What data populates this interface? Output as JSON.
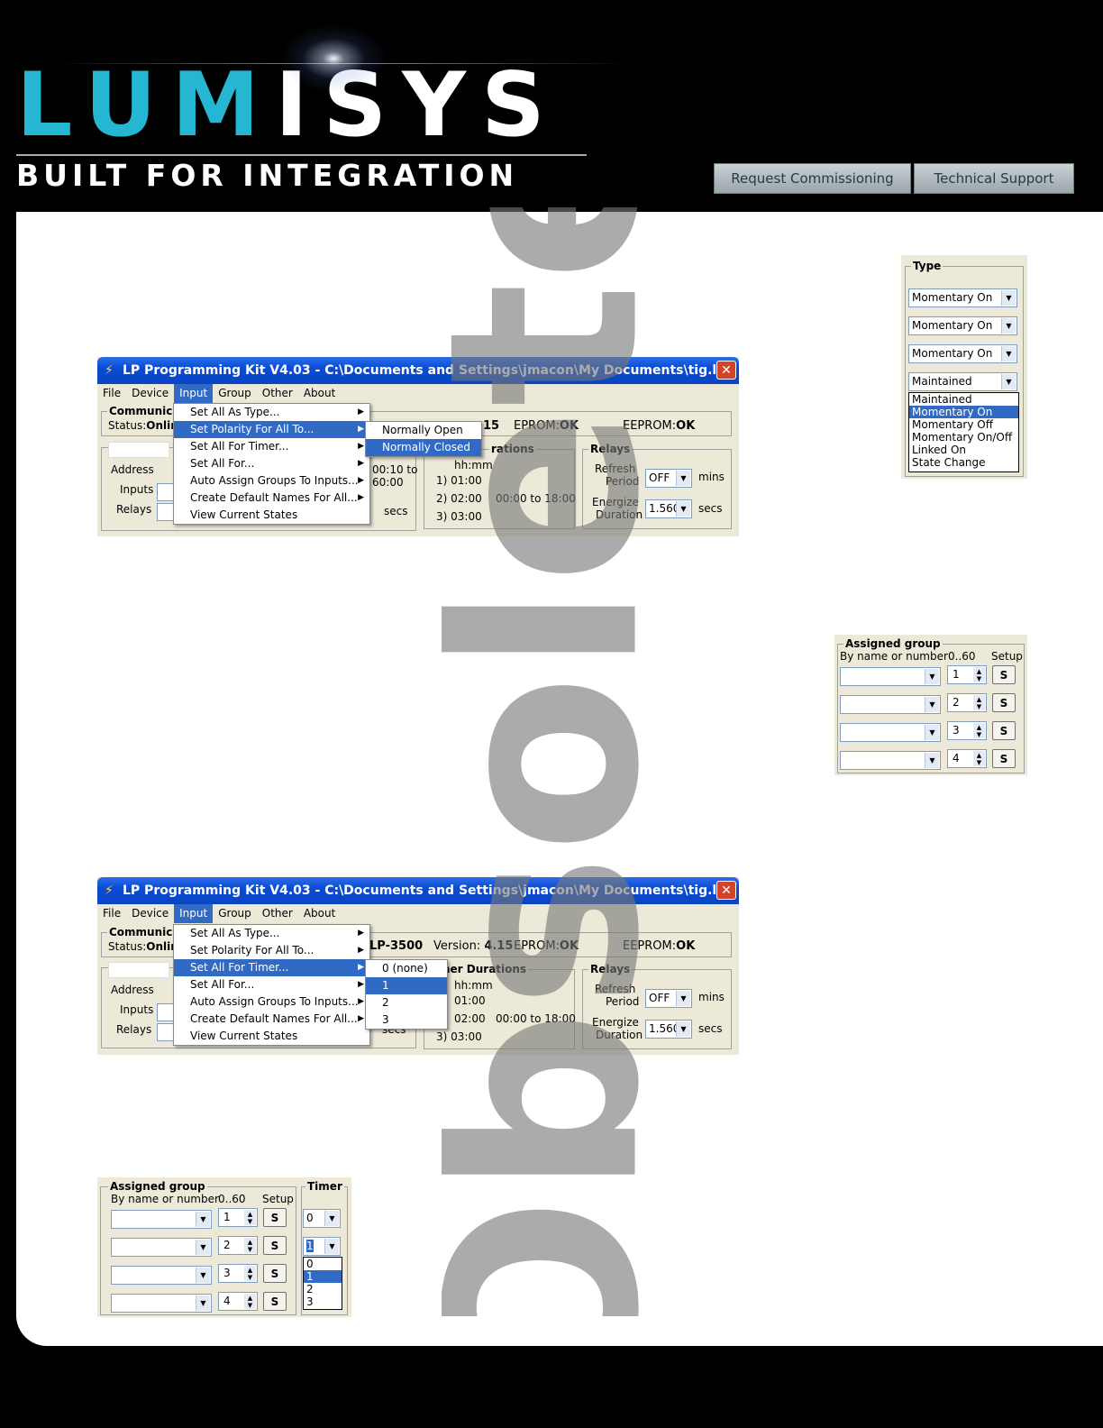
{
  "header": {
    "logo_lu": "LUM",
    "logo_i": "I",
    "logo_sys": "SYS",
    "tagline": "BUILT FOR INTEGRATION",
    "buttons": [
      "Request Commissioning",
      "Technical Support"
    ]
  },
  "watermark": "Obsolete",
  "window1": {
    "title": "LP Programming Kit V4.03 - C:\\Documents and Settings\\jmacon\\My Documents\\tig.lpx",
    "menu": [
      "File",
      "Device",
      "Input",
      "Group",
      "Other",
      "About"
    ],
    "comm_title": "Communica",
    "status_label": "Status:",
    "status_value": "Onlin",
    "version_partial": "15",
    "eprom_label": "EPROM:",
    "eprom_value": "OK",
    "eeprom_label": "EEPROM:",
    "eeprom_value": "OK",
    "address_label": "Address",
    "inputs_label": "Inputs",
    "relays_label": "Relays",
    "timer_range_a": "00:10 to",
    "timer_range_b": "60:00",
    "secs": "secs",
    "durations_title": "rations",
    "hhmm": "hh:mm",
    "durations": [
      "1)  01:00",
      "2)  02:00",
      "3)  03:00"
    ],
    "dur_range": "00:00 to 18:00",
    "relays_title": "Relays",
    "refresh_label_a": "Refresh",
    "refresh_label_b": "Period",
    "refresh_value": "OFF",
    "mins": "mins",
    "energize_label_a": "Energize",
    "energize_label_b": "Duration",
    "energize_value": "1.560",
    "input_menu": [
      "Set All As Type...",
      "Set Polarity For All To...",
      "Set All For Timer...",
      "Set All For...",
      "Auto Assign Groups To Inputs...",
      "Create Default Names For All...",
      "View Current States"
    ],
    "submenu": [
      "Normally Open",
      "Normally Closed"
    ]
  },
  "type_panel": {
    "title": "Type",
    "combos": [
      "Momentary On",
      "Momentary On",
      "Momentary On",
      "Maintained"
    ],
    "options": [
      "Maintained",
      "Momentary On",
      "Momentary Off",
      "Momentary On/Off",
      "Linked On",
      "State Change"
    ],
    "selected": "Momentary On"
  },
  "group_panel_right": {
    "title": "Assigned group",
    "col1": "By name or number",
    "col2": "0..60",
    "col3": "Setup",
    "numbers": [
      "1",
      "2",
      "3",
      "4"
    ],
    "btn": "S"
  },
  "window2": {
    "title": "LP Programming Kit V4.03 - C:\\Documents and Settings\\jmacon\\My Documents\\tig.lpx",
    "menu": [
      "File",
      "Device",
      "Input",
      "Group",
      "Other",
      "About"
    ],
    "comm_title": "Communica",
    "status_label": "Status:",
    "status_value": "Onlin",
    "model": "LP-3500",
    "version_label": "Version:",
    "version_value": "4.15",
    "eprom_label": "EPROM:",
    "eprom_value": "OK",
    "eeprom_label": "EEPROM:",
    "eeprom_value": "OK",
    "address_label": "Address",
    "inputs_label": "Inputs",
    "relays_label": "Relays",
    "secs": "secs",
    "durations_title": "ner Durations",
    "hhmm": "hh:mm",
    "durations": [
      "01:00",
      "02:00",
      "3)  03:00"
    ],
    "dur_range": "00:00 to 18:00",
    "relays_title": "Relays",
    "refresh_label_a": "Refresh",
    "refresh_label_b": "Period",
    "refresh_value": "OFF",
    "mins": "mins",
    "energize_label_a": "Energize",
    "energize_label_b": "Duration",
    "energize_value": "1.560",
    "input_menu": [
      "Set All As Type...",
      "Set Polarity For All To...",
      "Set All For Timer...",
      "Set All For...",
      "Auto Assign Groups To Inputs...",
      "Create Default Names For All...",
      "View Current States"
    ],
    "submenu": [
      "0 (none)",
      "1",
      "2",
      "3"
    ]
  },
  "group_panel_left": {
    "title": "Assigned group",
    "col1": "By name or number",
    "col2": "0..60",
    "col3": "Setup",
    "numbers": [
      "1",
      "2",
      "3",
      "4"
    ],
    "btn": "S",
    "timer_title": "Timer",
    "timer_values": [
      "0",
      "1"
    ],
    "timer_options": [
      "0",
      "1",
      "2",
      "3"
    ]
  }
}
